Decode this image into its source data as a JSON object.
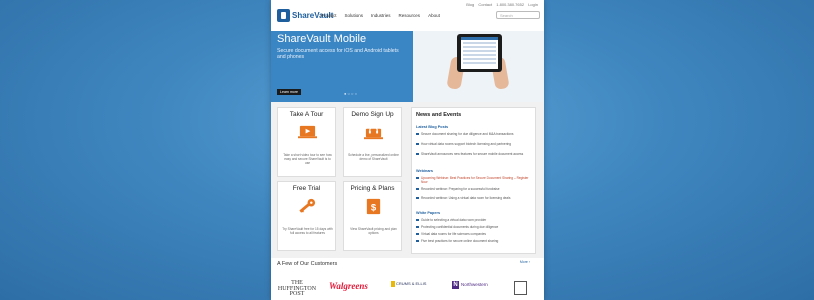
{
  "header": {
    "logo_text": "ShareVault",
    "utility": [
      "Blog",
      "Contact",
      "1.800.380.7652",
      "Login"
    ],
    "nav": [
      "Product",
      "Solutions",
      "Industries",
      "Resources",
      "About"
    ],
    "search_placeholder": "Search"
  },
  "hero": {
    "title": "ShareVault Mobile",
    "subtitle": "Secure document access for iOS and Android tablets and phones",
    "button_label": "Learn more",
    "pager": "● ○ ○ ○"
  },
  "cards": [
    {
      "title": "Take A Tour",
      "icon": "play-video-icon",
      "text": "Take a short video tour to see how easy and secure ShareVault is to use"
    },
    {
      "title": "Demo Sign Up",
      "icon": "headset-laptop-icon",
      "text": "Schedule a live, personalized online demo of ShareVault"
    },
    {
      "title": "Free Trial",
      "icon": "key-icon",
      "text": "Try ShareVault free for 15 days with full access to all features"
    },
    {
      "title": "Pricing & Plans",
      "icon": "dollar-tag-icon",
      "text": "View ShareVault pricing and plan options"
    }
  ],
  "news": {
    "title": "News and Events",
    "sections": [
      {
        "heading": "Latest Blog Posts",
        "items": [
          {
            "text": "Secure document sharing for due diligence and M&A transactions",
            "highlight": false
          },
          {
            "text": "How virtual data rooms support biotech licensing and partnering",
            "highlight": false
          },
          {
            "text": "ShareVault announces new features for secure mobile document access",
            "highlight": false
          }
        ]
      },
      {
        "heading": "Webinars",
        "items": [
          {
            "text": "Upcoming Webinar: Best Practices for Secure Document Sharing – Register Now",
            "highlight": true
          },
          {
            "text": "Recorded webinar: Preparing for a successful fundraise",
            "highlight": false
          },
          {
            "text": "Recorded webinar: Using a virtual data room for licensing deals",
            "highlight": false
          }
        ]
      },
      {
        "heading": "White Papers",
        "items": [
          {
            "text": "Guide to selecting a virtual data room provider",
            "highlight": false
          },
          {
            "text": "Protecting confidential documents during due diligence",
            "highlight": false
          },
          {
            "text": "Virtual data rooms for life sciences companies",
            "highlight": false
          },
          {
            "text": "Five best practices for secure online document sharing",
            "highlight": false
          }
        ]
      }
    ]
  },
  "customers": {
    "title": "A Few of Our Customers",
    "more": "More ›",
    "logos": [
      "THE HUFFINGTON POST",
      "Walgreens",
      "CRUMS & ELLIS",
      "Northwestern"
    ]
  }
}
